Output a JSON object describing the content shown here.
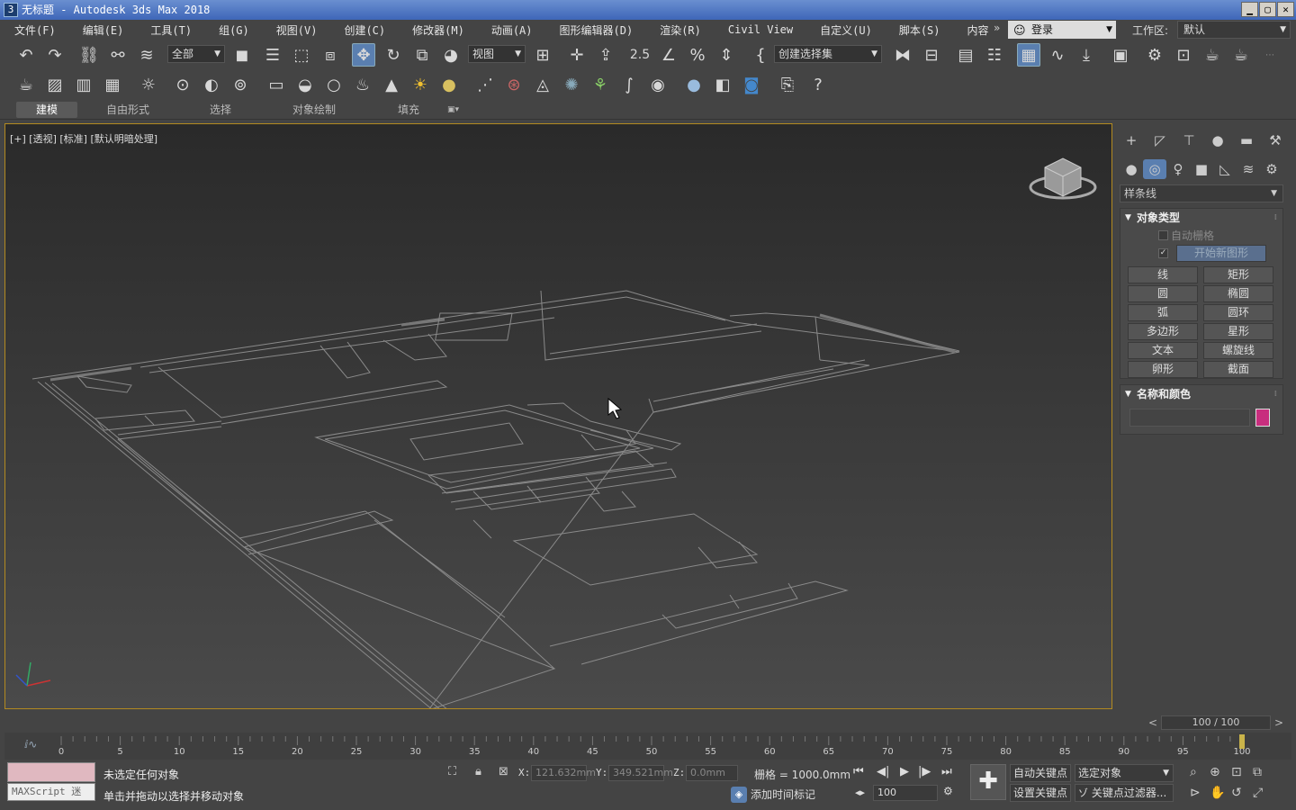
{
  "window": {
    "title": "无标题 - Autodesk 3ds Max 2018",
    "app_icon": "3",
    "controls": {
      "minimize": "▁",
      "maximize": "▢",
      "close": "✕"
    }
  },
  "menu": [
    "文件(F)",
    "编辑(E)",
    "工具(T)",
    "组(G)",
    "视图(V)",
    "创建(C)",
    "修改器(M)",
    "动画(A)",
    "图形编辑器(D)",
    "渲染(R)",
    "Civil View",
    "自定义(U)",
    "脚本(S)",
    "内容"
  ],
  "menu_overflow": "»",
  "login": {
    "label": "登录"
  },
  "workspace": {
    "label": "工作区:",
    "value": "默认"
  },
  "toolbar": {
    "selection_filter": "全部",
    "ref_coord": "视图",
    "named_selection": "创建选择集",
    "spinner_snap_label": "2.5"
  },
  "ribbon_tabs": [
    "建模",
    "自由形式",
    "选择",
    "对象绘制",
    "填充"
  ],
  "ribbon_active": "建模",
  "viewport": {
    "label": "[+] [透视] [标准] [默认明暗处理]"
  },
  "command_panel": {
    "category": "样条线",
    "object_type": {
      "title": "对象类型",
      "auto_grid": "自动栅格",
      "start_new_shape": "开始新图形",
      "buttons": [
        "线",
        "矩形",
        "圆",
        "椭圆",
        "弧",
        "圆环",
        "多边形",
        "星形",
        "文本",
        "螺旋线",
        "卵形",
        "截面"
      ]
    },
    "name_color": {
      "title": "名称和颜色",
      "name_value": "",
      "color": "#c82e7e"
    }
  },
  "time": {
    "slider_text": "100 / 100",
    "ticks": [
      0,
      5,
      10,
      15,
      20,
      25,
      30,
      35,
      40,
      45,
      50,
      55,
      60,
      65,
      70,
      75,
      80,
      85,
      90,
      95,
      100
    ],
    "current_frame": 100
  },
  "status": {
    "maxscript": "MAXScript 迷",
    "line1": "未选定任何对象",
    "line2": "单击并拖动以选择并移动对象",
    "x_label": "X:",
    "x_value": "121.632mm",
    "y_label": "Y:",
    "y_value": "349.521mm",
    "z_label": "Z:",
    "z_value": "0.0mm",
    "grid": "栅格 = 1000.0mm",
    "add_time_tag": "添加时间标记",
    "frame": "100",
    "auto_key": "自动关键点",
    "set_key": "设置关键点",
    "selected_object": "选定对象",
    "key_filters": "关键点过滤器..."
  }
}
